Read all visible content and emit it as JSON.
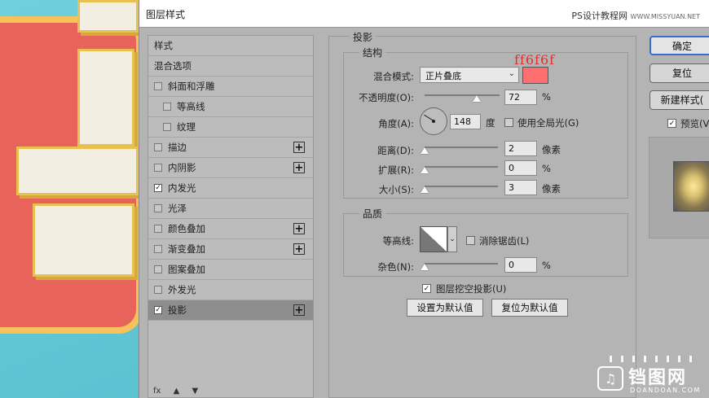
{
  "dialog": {
    "title": "图层样式",
    "watermark_main": "PS设计教程网",
    "watermark_url": "WWW.MISSYUAN.NET"
  },
  "stylelist": {
    "items": [
      {
        "label": "样式",
        "checkbox": false,
        "checked": false,
        "indent": false,
        "plus": false,
        "active": false
      },
      {
        "label": "混合选项",
        "checkbox": false,
        "checked": false,
        "indent": false,
        "plus": false,
        "active": false
      },
      {
        "label": "斜面和浮雕",
        "checkbox": true,
        "checked": false,
        "indent": false,
        "plus": false,
        "active": false
      },
      {
        "label": "等高线",
        "checkbox": true,
        "checked": false,
        "indent": true,
        "plus": false,
        "active": false
      },
      {
        "label": "纹理",
        "checkbox": true,
        "checked": false,
        "indent": true,
        "plus": false,
        "active": false
      },
      {
        "label": "描边",
        "checkbox": true,
        "checked": false,
        "indent": false,
        "plus": true,
        "active": false
      },
      {
        "label": "内阴影",
        "checkbox": true,
        "checked": false,
        "indent": false,
        "plus": true,
        "active": false
      },
      {
        "label": "内发光",
        "checkbox": true,
        "checked": true,
        "indent": false,
        "plus": false,
        "active": false
      },
      {
        "label": "光泽",
        "checkbox": true,
        "checked": false,
        "indent": false,
        "plus": false,
        "active": false
      },
      {
        "label": "颜色叠加",
        "checkbox": true,
        "checked": false,
        "indent": false,
        "plus": true,
        "active": false
      },
      {
        "label": "渐变叠加",
        "checkbox": true,
        "checked": false,
        "indent": false,
        "plus": true,
        "active": false
      },
      {
        "label": "图案叠加",
        "checkbox": true,
        "checked": false,
        "indent": false,
        "plus": false,
        "active": false
      },
      {
        "label": "外发光",
        "checkbox": true,
        "checked": false,
        "indent": false,
        "plus": false,
        "active": false
      },
      {
        "label": "投影",
        "checkbox": true,
        "checked": true,
        "indent": false,
        "plus": true,
        "active": true
      }
    ],
    "footer": "fx"
  },
  "drop_shadow": {
    "section_title": "投影",
    "structure_title": "结构",
    "blend_mode_label": "混合模式:",
    "blend_mode_value": "正片叠底",
    "color_annotation": "ff6f6f",
    "color_hex": "#ff6f6f",
    "opacity_label": "不透明度(O):",
    "opacity_value": "72",
    "opacity_unit": "%",
    "angle_label": "角度(A):",
    "angle_value": "148",
    "angle_unit": "度",
    "global_light_label": "使用全局光(G)",
    "global_light_checked": false,
    "distance_label": "距离(D):",
    "distance_value": "2",
    "distance_unit": "像素",
    "spread_label": "扩展(R):",
    "spread_value": "0",
    "spread_unit": "%",
    "size_label": "大小(S):",
    "size_value": "3",
    "size_unit": "像素",
    "quality_title": "品质",
    "contour_label": "等高线:",
    "antialias_label": "消除锯齿(L)",
    "antialias_checked": false,
    "noise_label": "杂色(N):",
    "noise_value": "0",
    "noise_unit": "%",
    "knockout_label": "图层挖空投影(U)",
    "knockout_checked": true,
    "set_default_label": "设置为默认值",
    "reset_default_label": "复位为默认值"
  },
  "side_buttons": {
    "ok": "确定",
    "reset": "复位",
    "new_style": "新建样式(",
    "preview_label": "预览(V",
    "preview_checked": true
  },
  "logo": {
    "text": "铛图网",
    "sub": "DOANDOAN.COM"
  }
}
